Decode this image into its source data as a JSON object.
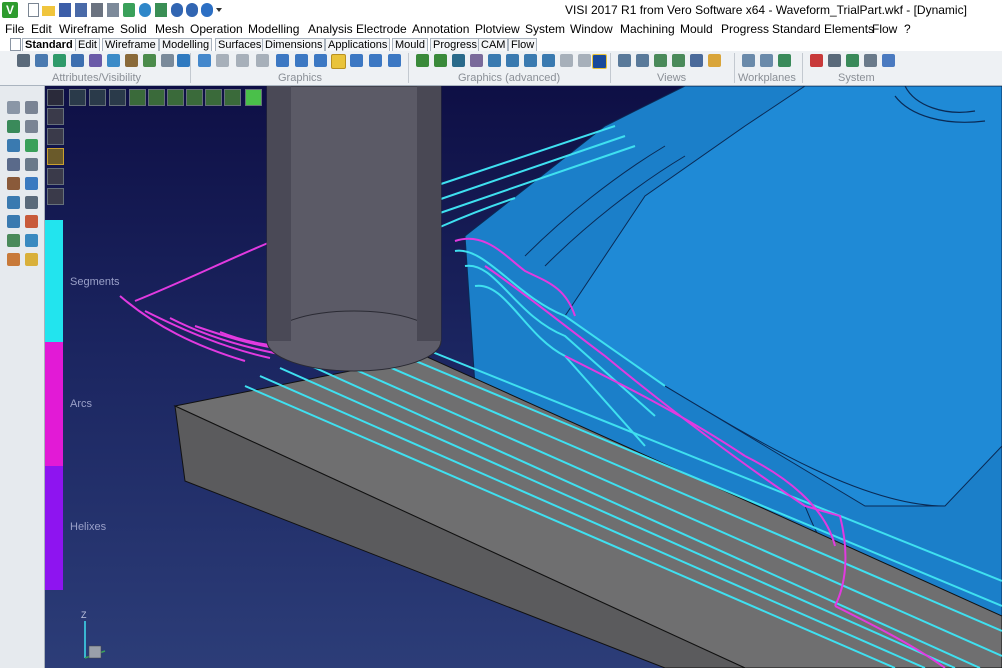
{
  "title": {
    "app_letter": "V",
    "text": "VISI 2017 R1   from Vero Software x64 - Waveform_TrialPart.wkf - [Dynamic]"
  },
  "menu": [
    "File",
    "Edit",
    "Wireframe",
    "Solid",
    "Mesh",
    "Operation",
    "Modelling",
    "Analysis",
    "Electrode",
    "Annotation",
    "Plotview",
    "System",
    "Window",
    "Machining",
    "Mould",
    "Progress",
    "Standard Elements",
    "Flow",
    "?"
  ],
  "tabs": [
    "Standard",
    "Edit",
    "Wireframe",
    "Modelling",
    "Surfaces",
    "Dimensions",
    "Applications",
    "Mould",
    "Progress",
    "CAM",
    "Flow"
  ],
  "active_tab": "Standard",
  "ribbon_groups": [
    "Attributes/Visibility",
    "Graphics",
    "Graphics (advanced)",
    "Views",
    "Workplanes",
    "System"
  ],
  "legend": [
    {
      "label": "Segments",
      "color": "#22e4ee"
    },
    {
      "label": "Arcs",
      "color": "#e21ad6"
    },
    {
      "label": "Helixes",
      "color": "#8e14f0"
    }
  ],
  "axis": {
    "z": "Z"
  },
  "colors": {
    "toolpath_line": "#3fe0f0",
    "toolpath_arc": "#e23ae0",
    "part_surface": "#1b7fc9",
    "stock_block": "#6f6f70"
  }
}
